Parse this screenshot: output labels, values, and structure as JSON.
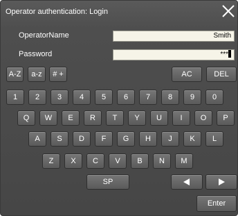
{
  "dialog": {
    "title": "Operator authentication: Login",
    "close_icon": "close-x-icon"
  },
  "fields": {
    "operator_name": {
      "label": "OperatorName",
      "value": "Smith"
    },
    "password": {
      "label": "Password",
      "value": "***"
    }
  },
  "keyboard": {
    "mode_keys": [
      "A-Z",
      "a-z",
      "# +"
    ],
    "ac_label": "AC",
    "del_label": "DEL",
    "number_row": [
      "1",
      "2",
      "3",
      "4",
      "5",
      "6",
      "7",
      "8",
      "9",
      "0"
    ],
    "row_q": [
      "Q",
      "W",
      "E",
      "R",
      "T",
      "Y",
      "U",
      "I",
      "O",
      "P"
    ],
    "row_a": [
      "A",
      "S",
      "D",
      "F",
      "G",
      "H",
      "J",
      "K",
      "L"
    ],
    "row_z": [
      "Z",
      "X",
      "C",
      "V",
      "B",
      "N",
      "M"
    ],
    "space_label": "SP",
    "left_arrow_icon": "left-triangle-icon",
    "right_arrow_icon": "right-triangle-icon",
    "enter_label": "Enter"
  }
}
